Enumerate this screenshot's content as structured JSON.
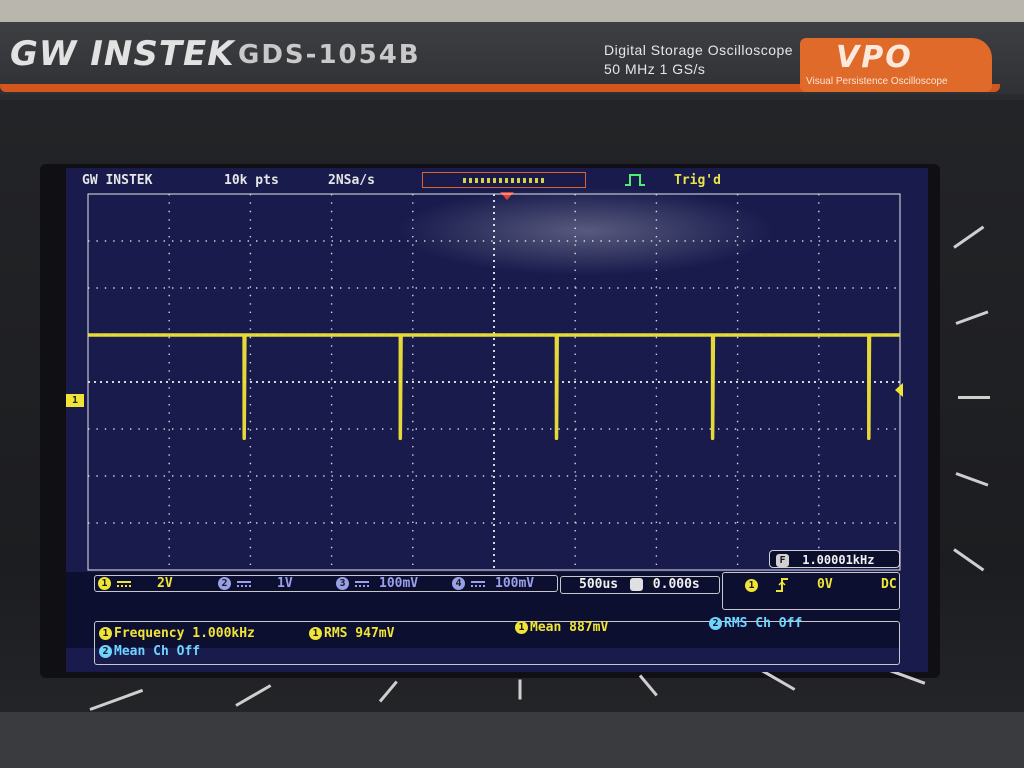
{
  "instrument": {
    "brand": "GW INSTEK",
    "model": "GDS-1054B",
    "description_line1": "Digital Storage Oscilloscope",
    "description_line2": "50 MHz  1 GS/s",
    "badge": "VPO",
    "badge_subtitle": "Visual Persistence Oscilloscope",
    "accent_color": "#d4561f"
  },
  "screen": {
    "status": {
      "brand": "GW INSTEK",
      "record_length": "10k pts",
      "sample_rate": "2NSa/s",
      "trigger_status": "Trig'd"
    },
    "ch1_marker": "1",
    "frequency_counter": {
      "label": "F",
      "value": "1.00001kHz"
    },
    "channels": [
      {
        "num": "1",
        "scale": "2V",
        "color": "#f0e437"
      },
      {
        "num": "2",
        "scale": "1V",
        "color": "#6fd4ff"
      },
      {
        "num": "3",
        "scale": "100mV",
        "color": "#9aa0e8"
      },
      {
        "num": "4",
        "scale": "100mV",
        "color": "#9aa0e8"
      }
    ],
    "timebase": {
      "scale": "500us",
      "h_label": "H",
      "position": "0.000s"
    },
    "trigger": {
      "source": "1",
      "slope": "rising",
      "level": "0V",
      "coupling": "DC"
    },
    "measurements": [
      {
        "source": "1",
        "text": "Frequency 1.000kHz"
      },
      {
        "source": "1",
        "text": "RMS 947mV"
      },
      {
        "source": "1",
        "text": "Mean 887mV"
      },
      {
        "source": "2",
        "text": "RMS Ch Off"
      },
      {
        "source": "2",
        "text": "Mean Ch Off"
      }
    ]
  },
  "chart_data": {
    "type": "line",
    "series": [
      {
        "color": "#f0e437",
        "x": [
          0,
          0.5,
          0.9999,
          1.0,
          1.005,
          1.01,
          1.5,
          1.9999,
          2.0,
          2.005,
          2.01,
          2.5,
          2.9999,
          3.0,
          3.005,
          3.01,
          3.5,
          3.9999,
          4.0,
          4.005,
          4.01,
          4.5,
          4.9999,
          5.0,
          5.005,
          5.01,
          5.2
        ],
        "y": [
          1.0,
          1.0,
          1.0,
          -1.2,
          1.0,
          1.0,
          1.0,
          1.0,
          -1.2,
          1.0,
          1.0,
          1.0,
          1.0,
          -1.2,
          1.0,
          1.0,
          1.0,
          1.0,
          -1.2,
          1.0,
          1.0,
          1.0,
          1.0,
          -1.2,
          1.0,
          1.0,
          1.0
        ]
      }
    ],
    "grid": true,
    "divisions": {
      "horizontal": 10,
      "vertical": 8
    }
  }
}
